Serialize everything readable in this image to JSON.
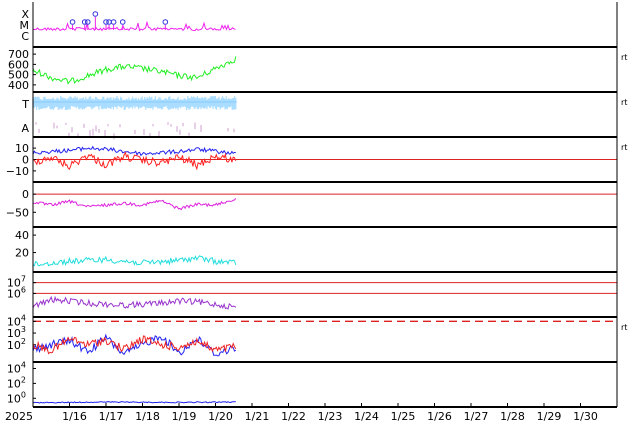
{
  "chart_data": {
    "type": "line",
    "x_range": [
      "2025-01-15",
      "2025-01-31"
    ],
    "x_ticks": [
      {
        "date": "2025-01-15",
        "label": "2025"
      },
      {
        "date": "2025-01-16",
        "label": "1/16"
      },
      {
        "date": "2025-01-17",
        "label": "1/17"
      },
      {
        "date": "2025-01-18",
        "label": "1/18"
      },
      {
        "date": "2025-01-19",
        "label": "1/19"
      },
      {
        "date": "2025-01-20",
        "label": "1/20"
      },
      {
        "date": "2025-01-21",
        "label": "1/21"
      },
      {
        "date": "2025-01-22",
        "label": "1/22"
      },
      {
        "date": "2025-01-23",
        "label": "1/23"
      },
      {
        "date": "2025-01-24",
        "label": "1/24"
      },
      {
        "date": "2025-01-25",
        "label": "1/25"
      },
      {
        "date": "2025-01-26",
        "label": "1/26"
      },
      {
        "date": "2025-01-27",
        "label": "1/27"
      },
      {
        "date": "2025-01-28",
        "label": "1/28"
      },
      {
        "date": "2025-01-29",
        "label": "1/29"
      },
      {
        "date": "2025-01-30",
        "label": "1/30"
      }
    ],
    "data_end": "2025-01-20T14:00",
    "colors": {
      "flare": "#ee22ee",
      "speed": "#22ee22",
      "temp": "#aaddff",
      "alpha": "#ddbbdd",
      "bz": "#ff2222",
      "bt": "#2222ee",
      "dst": "#dd22dd",
      "kp": "#22dddd",
      "electron": "#9933cc",
      "proton": "#ee2222",
      "ref": "#dd2222"
    },
    "panels": [
      {
        "id": "xray",
        "kind": "categorical",
        "tick_labels": [
          "X",
          "M",
          "C"
        ],
        "series": [
          {
            "color": "flare"
          }
        ],
        "flare_markers": [
          {
            "date": "2025-01-16T02:00",
            "level": "M"
          },
          {
            "date": "2025-01-16T10:00",
            "level": "M"
          },
          {
            "date": "2025-01-16T12:00",
            "level": "M"
          },
          {
            "date": "2025-01-16T17:00",
            "level": "X"
          },
          {
            "date": "2025-01-17T00:00",
            "level": "M"
          },
          {
            "date": "2025-01-17T02:00",
            "level": "M"
          },
          {
            "date": "2025-01-17T05:00",
            "level": "M"
          },
          {
            "date": "2025-01-17T11:00",
            "level": "M"
          },
          {
            "date": "2025-01-18T15:00",
            "level": "M"
          }
        ]
      },
      {
        "id": "speed",
        "kind": "linear",
        "ylim": [
          350,
          750
        ],
        "ticks": [
          {
            "v": 700,
            "label": "700"
          },
          {
            "v": 600,
            "label": "600"
          },
          {
            "v": 500,
            "label": "500"
          },
          {
            "v": 400,
            "label": "400"
          }
        ],
        "right_label": "rt",
        "series": [
          {
            "color": "speed",
            "points": [
              [
                "2025-01-15T00:00",
                540
              ],
              [
                "2025-01-15T06:00",
                510
              ],
              [
                "2025-01-15T12:00",
                470
              ],
              [
                "2025-01-16T00:00",
                430
              ],
              [
                "2025-01-16T12:00",
                490
              ],
              [
                "2025-01-17T00:00",
                550
              ],
              [
                "2025-01-17T12:00",
                580
              ],
              [
                "2025-01-18T00:00",
                560
              ],
              [
                "2025-01-18T12:00",
                530
              ],
              [
                "2025-01-19T00:00",
                490
              ],
              [
                "2025-01-19T12:00",
                470
              ],
              [
                "2025-01-20T00:00",
                560
              ],
              [
                "2025-01-20T14:00",
                660
              ]
            ]
          }
        ]
      },
      {
        "id": "plasma",
        "kind": "categorical",
        "tick_labels": [
          "T",
          "A"
        ],
        "right_label": "rt",
        "series": [
          {
            "color": "temp"
          },
          {
            "color": "alpha"
          }
        ]
      },
      {
        "id": "imf",
        "kind": "linear",
        "ylim": [
          -18,
          18
        ],
        "ticks": [
          {
            "v": 10,
            "label": "10"
          },
          {
            "v": 0,
            "label": "0"
          },
          {
            "v": -10,
            "label": "−10"
          }
        ],
        "reference_lines": [
          {
            "v": 0,
            "color": "ref"
          }
        ],
        "right_label": "rt",
        "series": [
          {
            "color": "bt",
            "points": [
              [
                "2025-01-15T00:00",
                6
              ],
              [
                "2025-01-16T00:00",
                8
              ],
              [
                "2025-01-16T12:00",
                10
              ],
              [
                "2025-01-17T00:00",
                9
              ],
              [
                "2025-01-18T00:00",
                5
              ],
              [
                "2025-01-19T00:00",
                7
              ],
              [
                "2025-01-19T12:00",
                9
              ],
              [
                "2025-01-20T14:00",
                5
              ]
            ]
          },
          {
            "color": "bz",
            "points": [
              [
                "2025-01-15T00:00",
                -2
              ],
              [
                "2025-01-15T12:00",
                2
              ],
              [
                "2025-01-16T00:00",
                -6
              ],
              [
                "2025-01-16T12:00",
                4
              ],
              [
                "2025-01-17T00:00",
                -5
              ],
              [
                "2025-01-17T12:00",
                3
              ],
              [
                "2025-01-18T00:00",
                -1
              ],
              [
                "2025-01-18T12:00",
                -3
              ],
              [
                "2025-01-19T00:00",
                2
              ],
              [
                "2025-01-19T12:00",
                -5
              ],
              [
                "2025-01-20T00:00",
                3
              ],
              [
                "2025-01-20T14:00",
                -1
              ]
            ]
          }
        ]
      },
      {
        "id": "dst",
        "kind": "linear",
        "ylim": [
          -85,
          28
        ],
        "ticks": [
          {
            "v": 0,
            "label": "0"
          },
          {
            "v": -50,
            "label": "−50"
          }
        ],
        "reference_lines": [
          {
            "v": 0,
            "color": "ref"
          }
        ],
        "series": [
          {
            "color": "dst",
            "points": [
              [
                "2025-01-15T00:00",
                -22
              ],
              [
                "2025-01-15T12:00",
                -30
              ],
              [
                "2025-01-16T00:00",
                -20
              ],
              [
                "2025-01-16T12:00",
                -35
              ],
              [
                "2025-01-17T00:00",
                -30
              ],
              [
                "2025-01-17T12:00",
                -25
              ],
              [
                "2025-01-18T00:00",
                -30
              ],
              [
                "2025-01-18T12:00",
                -18
              ],
              [
                "2025-01-19T00:00",
                -40
              ],
              [
                "2025-01-19T12:00",
                -28
              ],
              [
                "2025-01-20T00:00",
                -30
              ],
              [
                "2025-01-20T14:00",
                -12
              ]
            ]
          }
        ]
      },
      {
        "id": "kp",
        "kind": "linear",
        "ylim": [
          0,
          47
        ],
        "ticks": [
          {
            "v": 40,
            "label": "40"
          },
          {
            "v": 20,
            "label": "20"
          }
        ],
        "series": [
          {
            "color": "kp",
            "points": [
              [
                "2025-01-15T00:00",
                6
              ],
              [
                "2025-01-15T12:00",
                8
              ],
              [
                "2025-01-16T00:00",
                10
              ],
              [
                "2025-01-17T00:00",
                12
              ],
              [
                "2025-01-17T12:00",
                10
              ],
              [
                "2025-01-18T00:00",
                8
              ],
              [
                "2025-01-19T00:00",
                11
              ],
              [
                "2025-01-19T12:00",
                14
              ],
              [
                "2025-01-20T00:00",
                10
              ],
              [
                "2025-01-20T14:00",
                8
              ]
            ]
          }
        ]
      },
      {
        "id": "electron",
        "kind": "log",
        "ylim": [
          4,
          7.8
        ],
        "ticks": [
          {
            "v": 7,
            "base": "10",
            "exp": "7"
          },
          {
            "v": 6,
            "base": "10",
            "exp": "6"
          }
        ],
        "reference_lines": [
          {
            "v": 7,
            "color": "ref"
          },
          {
            "v": 6,
            "color": "ref"
          }
        ],
        "series": [
          {
            "color": "electron",
            "points": [
              [
                "2025-01-15T00:00",
                4.8
              ],
              [
                "2025-01-15T12:00",
                5.4
              ],
              [
                "2025-01-16T00:00",
                5.3
              ],
              [
                "2025-01-16T12:00",
                5.1
              ],
              [
                "2025-01-17T00:00",
                5.0
              ],
              [
                "2025-01-17T12:00",
                4.9
              ],
              [
                "2025-01-18T12:00",
                5.1
              ],
              [
                "2025-01-19T00:00",
                5.3
              ],
              [
                "2025-01-19T12:00",
                5.2
              ],
              [
                "2025-01-20T00:00",
                5.0
              ],
              [
                "2025-01-20T14:00",
                4.7
              ]
            ]
          }
        ]
      },
      {
        "id": "proton",
        "kind": "log",
        "ylim": [
          0.7,
          4.2
        ],
        "ticks": [
          {
            "v": 4,
            "base": "10",
            "exp": "4"
          },
          {
            "v": 3,
            "base": "10",
            "exp": "3"
          },
          {
            "v": 2,
            "base": "10",
            "exp": "2"
          }
        ],
        "reference_lines": [
          {
            "v": 4,
            "color": "ref",
            "dashed": true
          }
        ],
        "right_label": "rt",
        "series": [
          {
            "color": "bt",
            "points": [
              [
                "2025-01-15T00:00",
                1.6
              ],
              [
                "2025-01-16T00:00",
                2.4
              ],
              [
                "2025-01-16T12:00",
                1.4
              ],
              [
                "2025-01-17T00:00",
                2.6
              ],
              [
                "2025-01-17T12:00",
                1.2
              ],
              [
                "2025-01-18T12:00",
                2.8
              ],
              [
                "2025-01-19T00:00",
                1.3
              ],
              [
                "2025-01-19T12:00",
                2.5
              ],
              [
                "2025-01-20T00:00",
                1.2
              ],
              [
                "2025-01-20T14:00",
                1.8
              ]
            ]
          },
          {
            "color": "proton",
            "points": [
              [
                "2025-01-15T00:00",
                2.0
              ],
              [
                "2025-01-15T12:00",
                1.5
              ],
              [
                "2025-01-16T00:00",
                2.5
              ],
              [
                "2025-01-16T12:00",
                2.0
              ],
              [
                "2025-01-17T00:00",
                2.4
              ],
              [
                "2025-01-17T12:00",
                1.6
              ],
              [
                "2025-01-18T00:00",
                2.5
              ],
              [
                "2025-01-18T12:00",
                2.0
              ],
              [
                "2025-01-19T00:00",
                1.8
              ],
              [
                "2025-01-19T12:00",
                2.3
              ],
              [
                "2025-01-20T00:00",
                1.5
              ],
              [
                "2025-01-20T14:00",
                1.9
              ]
            ]
          }
        ]
      },
      {
        "id": "proton-low",
        "kind": "log",
        "ylim": [
          -0.9,
          4.6
        ],
        "ticks": [
          {
            "v": 4,
            "base": "10",
            "exp": "4"
          },
          {
            "v": 2,
            "base": "10",
            "exp": "2"
          },
          {
            "v": 0,
            "base": "10",
            "exp": "0"
          }
        ],
        "series": [
          {
            "color": "bt",
            "points": [
              [
                "2025-01-15T00:00",
                -0.6
              ],
              [
                "2025-01-17T00:00",
                -0.5
              ],
              [
                "2025-01-19T00:00",
                -0.55
              ],
              [
                "2025-01-20T14:00",
                -0.5
              ]
            ]
          }
        ]
      }
    ]
  }
}
